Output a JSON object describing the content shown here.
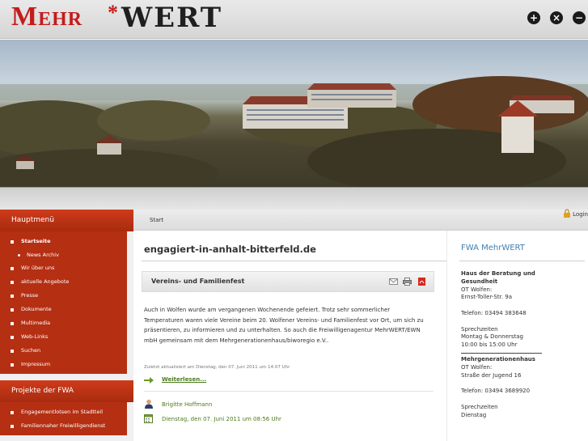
{
  "header": {
    "logo_mehr": "Mehr",
    "logo_star": "*",
    "logo_wert": "WERT",
    "controls": [
      "+",
      "×",
      "−"
    ]
  },
  "breadcrumb": {
    "item": "Start"
  },
  "login": {
    "label": "Login"
  },
  "sidebar": {
    "main_menu_title": "Hauptmenü",
    "items": [
      {
        "label": "Startseite",
        "active": true
      },
      {
        "label": "News Archiv",
        "sub": true
      },
      {
        "label": "Wir über uns"
      },
      {
        "label": "aktuelle Angebote"
      },
      {
        "label": "Presse"
      },
      {
        "label": "Dokumente"
      },
      {
        "label": "Multimedia"
      },
      {
        "label": "Web-Links"
      },
      {
        "label": "Suchen"
      },
      {
        "label": "Impressum"
      }
    ],
    "projects_title": "Projekte der FWA",
    "projects": [
      {
        "label": "Engagementlotsen im Stadtteil"
      },
      {
        "label": "Familiennaher Freiwilligendienst"
      }
    ]
  },
  "main": {
    "site_title": "engagiert-in-anhalt-bitterfeld.de",
    "article_title": "Vereins- und Familienfest",
    "body": "Auch in Wolfen wurde am vergangenen Wochenende gefeiert. Trotz sehr sommerlicher Temperaturen waren viele Vereine beim 20. Wolfener Vereins- und Familienfest vor Ort, um sich zu präsentieren, zu informieren und zu unterhalten. So auch die Freiwilligenagentur MehrWERT/EWN mbH gemeinsam mit dem Mehrgenerationenhaus/biworegio e.V..",
    "updated": "Zuletzt aktualisiert am Dienstag, den 07. Juni 2011 um 14:07 Uhr",
    "read_more": "Weiterlesen...",
    "author": "Brigitte Hoffmann",
    "date": "Dienstag, den 07. Juni 2011 um 08:56 Uhr"
  },
  "right": {
    "title": "FWA MehrWERT",
    "lines": [
      {
        "t": "Haus der Beratung und",
        "b": true
      },
      {
        "t": "Gesundheit",
        "b": true
      },
      {
        "t": "OT Wolfen:"
      },
      {
        "t": "Ernst-Toller-Str. 9a"
      },
      {
        "t": ""
      },
      {
        "t": "Telefon: 03494 383648"
      },
      {
        "t": ""
      },
      {
        "t": "Sprechzeiten"
      },
      {
        "t": "Montag & Donnerstag"
      },
      {
        "t": "10:00 bis 15:00 Uhr"
      },
      {
        "rule": true
      },
      {
        "t": "Mehrgenerationenhaus",
        "b": true
      },
      {
        "t": "OT Wolfen:"
      },
      {
        "t": "Straße der Jugend 16"
      },
      {
        "t": ""
      },
      {
        "t": "Telefon: 03494 3689920"
      },
      {
        "t": ""
      },
      {
        "t": "Sprechzeiten"
      },
      {
        "t": "Dienstag"
      }
    ]
  },
  "colors": {
    "brand_red": "#c51b1b",
    "menu_red": "#b52f13",
    "link_green": "#4c7a1b",
    "title_blue": "#3f7fb3"
  }
}
